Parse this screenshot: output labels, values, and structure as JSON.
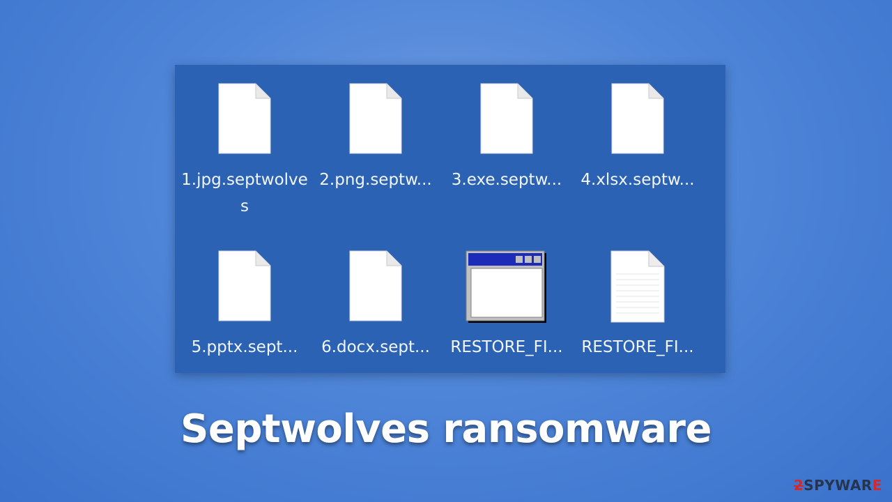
{
  "caption": "Septwolves ransomware",
  "watermark": {
    "prefix": "2",
    "main": "SPYWAR",
    "suffix": "E"
  },
  "files": [
    {
      "name": "1.jpg.septwolves",
      "icon": "document-icon"
    },
    {
      "name": "2.png.septw...",
      "icon": "document-icon"
    },
    {
      "name": "3.exe.septw...",
      "icon": "document-icon"
    },
    {
      "name": "4.xlsx.septw...",
      "icon": "document-icon"
    },
    {
      "name": "5.pptx.sept...",
      "icon": "document-icon"
    },
    {
      "name": "6.docx.sept...",
      "icon": "document-icon"
    },
    {
      "name": "RESTORE_FI...",
      "icon": "application-window-icon"
    },
    {
      "name": "RESTORE_FI...",
      "icon": "text-document-icon"
    }
  ]
}
